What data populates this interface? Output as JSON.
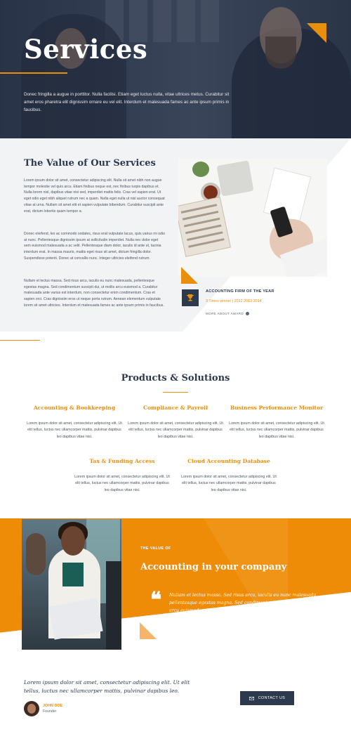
{
  "hero": {
    "title": "Services",
    "text": "Donec fringilla a augue in porttitor. Nulla facilisi. Etiam eget luctus nulla, vitae ultrices metus. Curabitur sit amet eros pharetra elit dignissim ornare eu vel elit. Interdum et malesuada fames ac ante ipsum primis in faucibus."
  },
  "value": {
    "title": "The Value of Our Services",
    "paragraphs": [
      "Lorem ipsum dolor sit amet, consectetur adipiscing elit. Nulla sit amet nibh non augue tempor molestie vel quis arcu. Etiam finibus neque est, nec finibus turpis dapibus et. Nulla lorem nisl, dapibus vitae nisi sed, imperdiet mattis felis. Cras vel sapien erat. Ut eget odio eget nibh aliquet rutrum nec a quam. Nulla eget nulla ut nisl auctor consequat vitae at urna. Nullam sit amet elit et sapien vulputate bibendum. Curabitur suscipit ante erat, dictum lobortis quam tempor a.",
      "Donec eleifend, leo ac commodo sodales, risus erat vulputate lacus, quis varius mi odio at nunc. Pellentesque dignissim ipsum at sollicitudin imperdiet. Nulla nec dolor eget sem euismod malesuada a ac velit. Pellentesque diam dolor, iaculis id ante ut, lacinia interdum erat. In massa mauris, mattis eget risus sit amet, dictum fringilla dolor. Suspendisse potenti. Donec at convallis nunc. Integer ultricies eleifend rutrum.",
      "Nullam et lectus massa. Sed risus arcu, iaculis eu nunc malesuada, pellentesque egestas magna. Sed condimentum suscipit dui, ut mollis arcu euismod a. Curabitur malesuada ante varius est interdum, non consectetur enim condimentum. Cras et sapien orci. Cras dignissim eros ut neque porta rutrum. Aenean elementum vulputate lorem sit amet ultricies. Interdum et malesuada fames ac ante ipsum primis in faucibus."
    ],
    "award": {
      "title": "ACCOUNTING FIRM OF THE YEAR",
      "subtitle": "3 Times winner | 2012 2013 2014",
      "link": "MORE ABOUT AWARD"
    }
  },
  "products": {
    "title": "Products & Solutions",
    "items": [
      {
        "title": "Accounting & Bookkeeping",
        "text": "Lorem ipsum dolor sit amet, consectetur adipiscing elit. Ut elit tellus, luctus nec ullamcorper mattis, pulvinar dapibus leo dapibus vitae nisi."
      },
      {
        "title": "Compliance & Payroll",
        "text": "Lorem ipsum dolor sit amet, consectetur adipiscing elit. Ut elit tellus, luctus nec ullamcorper mattis, pulvinar dapibus leo dapibus vitae nisi."
      },
      {
        "title": "Business Performance Monitor",
        "text": "Lorem ipsum dolor sit amet, consectetur adipiscing elit. Ut elit tellus, luctus nec ullamcorper mattis, pulvinar dapibus leo dapibus vitae nisi."
      },
      {
        "title": "Tax & Funding Access",
        "text": "Lorem ipsum dolor sit amet, consectetur adipiscing elit. Ut elit tellus, luctus nec ullamcorper mattis, pulvinar dapibus leo dapibus vitae nisi."
      },
      {
        "title": "Cloud Accounting Database",
        "text": "Lorem ipsum dolor sit amet, consectetur adipiscing elit. Ut elit tellus, luctus nec ullamcorper mattis, pulvinar dapibus leo dapibus vitae nisi."
      }
    ]
  },
  "band": {
    "eyebrow": "THE VALUE OF",
    "title": "Accounting in your company",
    "quote": "Nullam et lectus massa. Sed risus arcu, iaculis eu nunc malesuada, pellentesque egestas magna. Sed condimentum suscipit dui, ut mollis arcu euismod a. Curabitur malesuada ante varius est interdum, non consectetur enim condimentum."
  },
  "testimonial": {
    "quote": "Lorem ipsum dolor sit amet, consectetur adipiscing elit. Ut elit tellus, luctus nec ullamcorper mattis, pulvinar dapibus leo.",
    "name": "JOHN DOE",
    "role": "Founder",
    "contact_label": "CONTACT US"
  },
  "colors": {
    "accent": "#e8900b",
    "navy": "#2d3a4e",
    "band": "#ef8c07"
  },
  "icons": {
    "award": "trophy-icon",
    "link": "arrow-right-circle-icon",
    "quote": "quote-icon",
    "contact": "envelope-icon"
  }
}
